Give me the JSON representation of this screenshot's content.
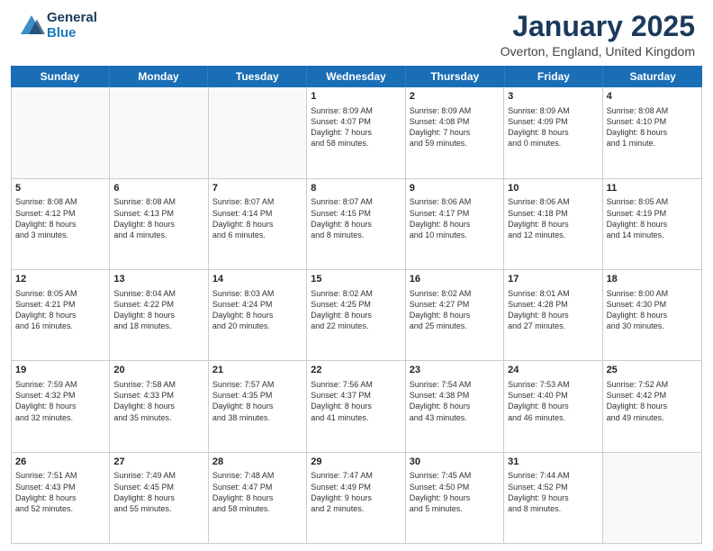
{
  "header": {
    "logo_line1": "General",
    "logo_line2": "Blue",
    "month": "January 2025",
    "location": "Overton, England, United Kingdom"
  },
  "days_of_week": [
    "Sunday",
    "Monday",
    "Tuesday",
    "Wednesday",
    "Thursday",
    "Friday",
    "Saturday"
  ],
  "weeks": [
    [
      {
        "day": "",
        "text": ""
      },
      {
        "day": "",
        "text": ""
      },
      {
        "day": "",
        "text": ""
      },
      {
        "day": "1",
        "text": "Sunrise: 8:09 AM\nSunset: 4:07 PM\nDaylight: 7 hours\nand 58 minutes."
      },
      {
        "day": "2",
        "text": "Sunrise: 8:09 AM\nSunset: 4:08 PM\nDaylight: 7 hours\nand 59 minutes."
      },
      {
        "day": "3",
        "text": "Sunrise: 8:09 AM\nSunset: 4:09 PM\nDaylight: 8 hours\nand 0 minutes."
      },
      {
        "day": "4",
        "text": "Sunrise: 8:08 AM\nSunset: 4:10 PM\nDaylight: 8 hours\nand 1 minute."
      }
    ],
    [
      {
        "day": "5",
        "text": "Sunrise: 8:08 AM\nSunset: 4:12 PM\nDaylight: 8 hours\nand 3 minutes."
      },
      {
        "day": "6",
        "text": "Sunrise: 8:08 AM\nSunset: 4:13 PM\nDaylight: 8 hours\nand 4 minutes."
      },
      {
        "day": "7",
        "text": "Sunrise: 8:07 AM\nSunset: 4:14 PM\nDaylight: 8 hours\nand 6 minutes."
      },
      {
        "day": "8",
        "text": "Sunrise: 8:07 AM\nSunset: 4:15 PM\nDaylight: 8 hours\nand 8 minutes."
      },
      {
        "day": "9",
        "text": "Sunrise: 8:06 AM\nSunset: 4:17 PM\nDaylight: 8 hours\nand 10 minutes."
      },
      {
        "day": "10",
        "text": "Sunrise: 8:06 AM\nSunset: 4:18 PM\nDaylight: 8 hours\nand 12 minutes."
      },
      {
        "day": "11",
        "text": "Sunrise: 8:05 AM\nSunset: 4:19 PM\nDaylight: 8 hours\nand 14 minutes."
      }
    ],
    [
      {
        "day": "12",
        "text": "Sunrise: 8:05 AM\nSunset: 4:21 PM\nDaylight: 8 hours\nand 16 minutes."
      },
      {
        "day": "13",
        "text": "Sunrise: 8:04 AM\nSunset: 4:22 PM\nDaylight: 8 hours\nand 18 minutes."
      },
      {
        "day": "14",
        "text": "Sunrise: 8:03 AM\nSunset: 4:24 PM\nDaylight: 8 hours\nand 20 minutes."
      },
      {
        "day": "15",
        "text": "Sunrise: 8:02 AM\nSunset: 4:25 PM\nDaylight: 8 hours\nand 22 minutes."
      },
      {
        "day": "16",
        "text": "Sunrise: 8:02 AM\nSunset: 4:27 PM\nDaylight: 8 hours\nand 25 minutes."
      },
      {
        "day": "17",
        "text": "Sunrise: 8:01 AM\nSunset: 4:28 PM\nDaylight: 8 hours\nand 27 minutes."
      },
      {
        "day": "18",
        "text": "Sunrise: 8:00 AM\nSunset: 4:30 PM\nDaylight: 8 hours\nand 30 minutes."
      }
    ],
    [
      {
        "day": "19",
        "text": "Sunrise: 7:59 AM\nSunset: 4:32 PM\nDaylight: 8 hours\nand 32 minutes."
      },
      {
        "day": "20",
        "text": "Sunrise: 7:58 AM\nSunset: 4:33 PM\nDaylight: 8 hours\nand 35 minutes."
      },
      {
        "day": "21",
        "text": "Sunrise: 7:57 AM\nSunset: 4:35 PM\nDaylight: 8 hours\nand 38 minutes."
      },
      {
        "day": "22",
        "text": "Sunrise: 7:56 AM\nSunset: 4:37 PM\nDaylight: 8 hours\nand 41 minutes."
      },
      {
        "day": "23",
        "text": "Sunrise: 7:54 AM\nSunset: 4:38 PM\nDaylight: 8 hours\nand 43 minutes."
      },
      {
        "day": "24",
        "text": "Sunrise: 7:53 AM\nSunset: 4:40 PM\nDaylight: 8 hours\nand 46 minutes."
      },
      {
        "day": "25",
        "text": "Sunrise: 7:52 AM\nSunset: 4:42 PM\nDaylight: 8 hours\nand 49 minutes."
      }
    ],
    [
      {
        "day": "26",
        "text": "Sunrise: 7:51 AM\nSunset: 4:43 PM\nDaylight: 8 hours\nand 52 minutes."
      },
      {
        "day": "27",
        "text": "Sunrise: 7:49 AM\nSunset: 4:45 PM\nDaylight: 8 hours\nand 55 minutes."
      },
      {
        "day": "28",
        "text": "Sunrise: 7:48 AM\nSunset: 4:47 PM\nDaylight: 8 hours\nand 58 minutes."
      },
      {
        "day": "29",
        "text": "Sunrise: 7:47 AM\nSunset: 4:49 PM\nDaylight: 9 hours\nand 2 minutes."
      },
      {
        "day": "30",
        "text": "Sunrise: 7:45 AM\nSunset: 4:50 PM\nDaylight: 9 hours\nand 5 minutes."
      },
      {
        "day": "31",
        "text": "Sunrise: 7:44 AM\nSunset: 4:52 PM\nDaylight: 9 hours\nand 8 minutes."
      },
      {
        "day": "",
        "text": ""
      }
    ]
  ]
}
